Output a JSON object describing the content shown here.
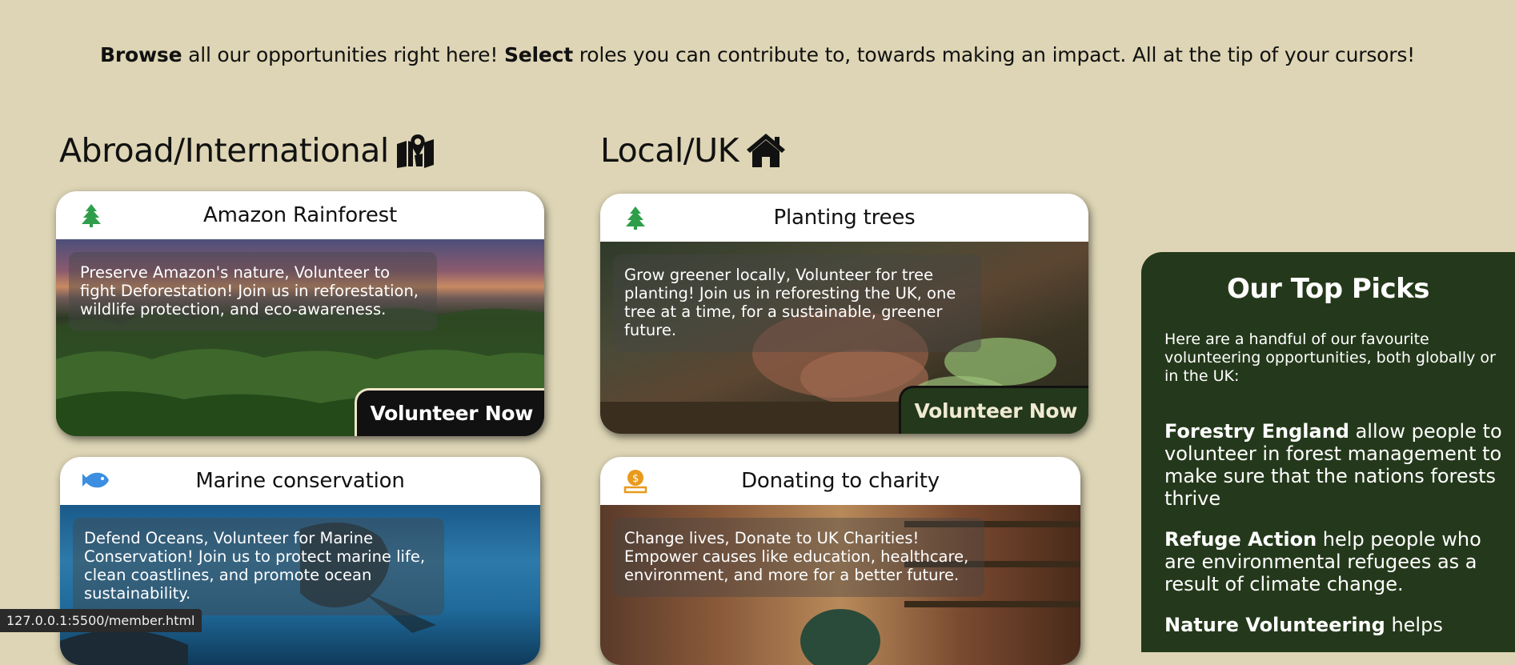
{
  "intro": {
    "browse": "Browse",
    "part1": " all our opportunities right here! ",
    "select": "Select",
    "part2": " roles you can contribute to, towards making an impact. All at the tip of your cursors!"
  },
  "sections": {
    "abroad": {
      "title": "Abroad/International",
      "icon": "map-location-icon"
    },
    "local": {
      "title": "Local/UK",
      "icon": "house-icon"
    }
  },
  "cards": {
    "amazon": {
      "title": "Amazon Rainforest",
      "icon": "tree-icon",
      "description": "Preserve Amazon's nature, Volunteer to fight Deforestation! Join us in reforestation, wildlife protection, and eco-awareness.",
      "button": "Volunteer Now"
    },
    "trees": {
      "title": "Planting trees",
      "icon": "tree-icon",
      "description": "Grow greener locally, Volunteer for tree planting! Join us in reforesting the UK, one tree at a time, for a sustainable, greener future.",
      "button": "Volunteer Now"
    },
    "marine": {
      "title": "Marine conservation",
      "icon": "fish-icon",
      "description": "Defend Oceans, Volunteer for Marine Conservation! Join us to protect marine life, clean coastlines, and promote ocean sustainability."
    },
    "charity": {
      "title": "Donating to charity",
      "icon": "donate-icon",
      "description": "Change lives, Donate to UK Charities! Empower causes like education, healthcare, environment, and more for a better future."
    }
  },
  "top_picks": {
    "title": "Our Top Picks",
    "intro": "Here are a handful of our favourite volunteering opportunities, both globally or in the UK:",
    "entries": [
      {
        "name": "Forestry England",
        "text": " allow people to volunteer in forest management to make sure that the nations forests thrive"
      },
      {
        "name": "Refuge Action",
        "text": " help people who are environmental refugees as a result of climate change."
      },
      {
        "name": "Nature Volunteering",
        "text": " helps"
      }
    ]
  },
  "status_bar": {
    "url": "127.0.0.1:5500/member.html"
  },
  "colors": {
    "background": "#ddd5b5",
    "panel": "#24391b",
    "tree_icon": "#2e9e4a",
    "fish_icon": "#3b8ee0",
    "donate_icon": "#e89a1c"
  }
}
